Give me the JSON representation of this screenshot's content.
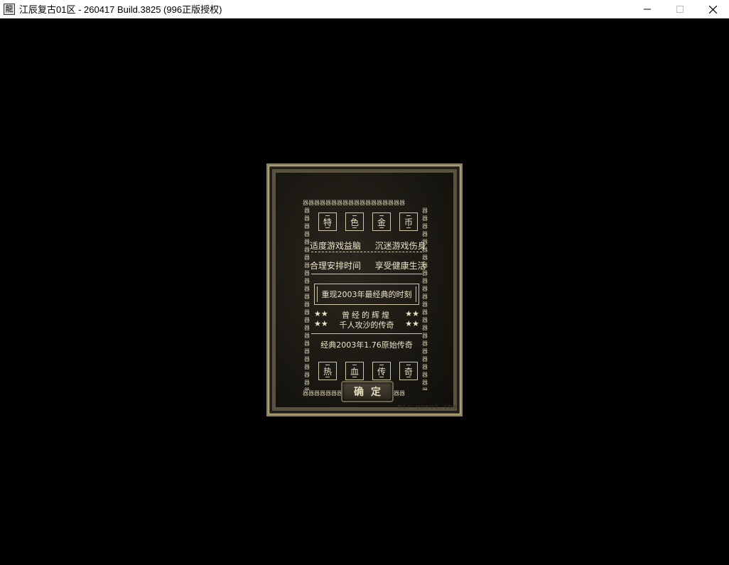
{
  "window": {
    "title": "江辰复古01区 - 260417 Build.3825 (996正版授权)",
    "icon_glyph": "龍",
    "buttons": [
      "minimize",
      "maximize",
      "close"
    ]
  },
  "dialog": {
    "top_chars": [
      "特",
      "色",
      "金",
      "币"
    ],
    "bottom_chars": [
      "热",
      "血",
      "传",
      "奇"
    ],
    "line1_left": "适度游戏益脑",
    "line1_right": "沉迷游戏伤身",
    "line2_left": "合理安排时间",
    "line2_right": "享受健康生活",
    "framed_text": "重现2003年最经典的时刻",
    "star_left": "★★",
    "star_right": "★★",
    "star_line1": "曾经的辉煌",
    "star_line2": "千人攻沙的传奇",
    "line3": "经典2003年1.76原始传奇",
    "confirm_label": "确定",
    "watermark": "mir.yusui.com",
    "pattern_glyph": "器"
  }
}
